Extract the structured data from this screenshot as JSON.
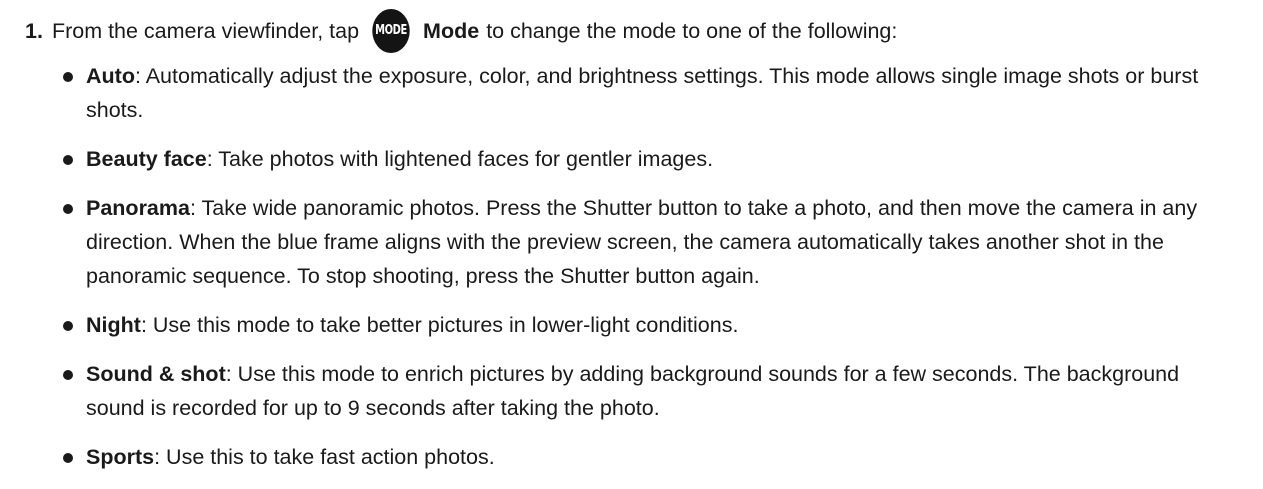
{
  "step": {
    "number": "1.",
    "before_icon": "From the camera viewfinder, tap",
    "icon_text": "MODE",
    "mode_label": "Mode",
    "after": "to change the mode to one of the following:"
  },
  "modes": [
    {
      "term": "Auto",
      "description": ": Automatically adjust the exposure, color, and brightness settings. This mode allows single image shots or burst shots."
    },
    {
      "term": "Beauty face",
      "description": ": Take photos with lightened faces for gentler images."
    },
    {
      "term": "Panorama",
      "description": ": Take wide panoramic photos. Press the Shutter button to take a photo, and then move the camera in any direction. When the blue frame aligns with the preview screen, the camera automatically takes another shot in the panoramic sequence. To stop shooting, press the Shutter button again."
    },
    {
      "term": "Night",
      "description": ": Use this mode to take better pictures in lower-light conditions."
    },
    {
      "term": "Sound & shot",
      "description": ": Use this mode to enrich pictures by adding background sounds for a few seconds. The background sound is recorded for up to 9 seconds after taking the photo."
    },
    {
      "term": "Sports",
      "description": ": Use this to take fast action photos."
    }
  ]
}
